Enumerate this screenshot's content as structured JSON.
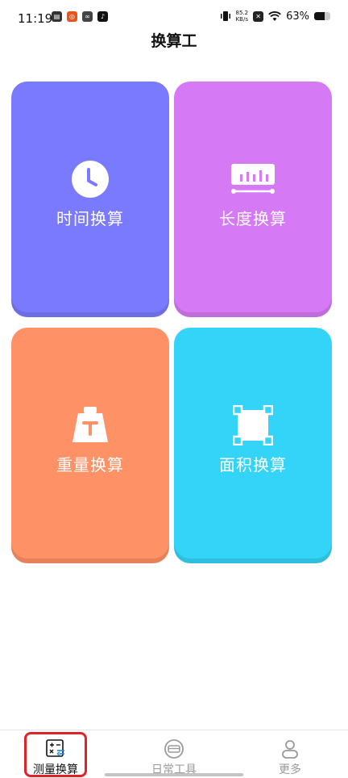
{
  "status_bar": {
    "time": "11:19",
    "netspeed_value": "85.2",
    "netspeed_unit": "KB/s",
    "battery_percent": "63%",
    "battery_level": 0.63
  },
  "header": {
    "title": "换算工"
  },
  "cards": [
    {
      "label": "时间换算",
      "color": "#7a7aff",
      "icon": "clock-icon"
    },
    {
      "label": "长度换算",
      "color": "#d57af4",
      "icon": "ruler-icon"
    },
    {
      "label": "重量换算",
      "color": "#ff9166",
      "icon": "weight-icon"
    },
    {
      "label": "面积换算",
      "color": "#34d4f8",
      "icon": "area-icon"
    }
  ],
  "tab_bar": {
    "tabs": [
      {
        "label": "测量换算",
        "active": true
      },
      {
        "label": "日常工具",
        "active": false
      },
      {
        "label": "更多",
        "active": false
      }
    ]
  },
  "colors": {
    "tab_active": "#111111",
    "tab_inactive": "#9a9a9a",
    "tab_icon_accent": "#2d8ee0",
    "highlight": "#e0222a"
  }
}
